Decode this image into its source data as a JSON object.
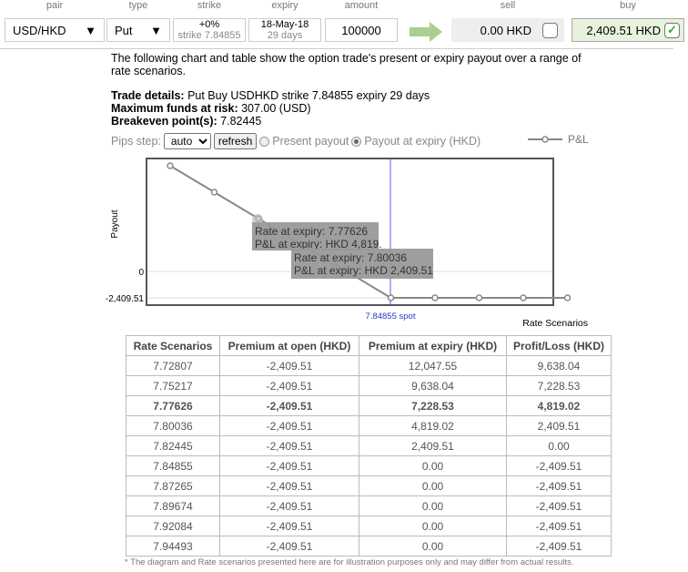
{
  "header": {
    "pair": "pair",
    "type": "type",
    "strike": "strike",
    "expiry": "expiry",
    "amount": "amount",
    "sell": "sell",
    "buy": "buy"
  },
  "form": {
    "pair": "USD/HKD",
    "type": "Put",
    "strike_pct": "+0%",
    "strike": "strike 7.84855",
    "expiry_date": "18-May-18",
    "expiry_days": "29 days",
    "amount": "100000",
    "sell_price": "0.00 HKD",
    "buy_price": "2,409.51 HKD",
    "buy_checked": true,
    "sell_checked": false
  },
  "intro": "The following chart and table show the option trade's present or expiry payout over a range of rate scenarios.",
  "details": {
    "trade_label": "Trade details:",
    "trade": " Put Buy USDHKD strike 7.84855 expiry 29 days",
    "risk_label": "Maximum funds at risk:",
    "risk": " 307.00 (USD)",
    "be_label": "Breakeven point(s):",
    "be": " 7.82445"
  },
  "controls": {
    "pips_label": "Pips step:",
    "pips_value": "auto",
    "refresh": "refresh",
    "present": "Present payout",
    "expiry": "Payout at expiry (HKD)",
    "selected": "expiry"
  },
  "chart_data": {
    "type": "line",
    "legend": "P&L",
    "ylabel": "Payout",
    "xlabel": "Rate Scenarios",
    "y_ticks": [
      "0",
      "-2,409.51"
    ],
    "spot_label": "7.84855 spot",
    "spot": 7.84855,
    "x": [
      7.72807,
      7.75217,
      7.77626,
      7.80036,
      7.82445,
      7.84855,
      7.87265,
      7.89674,
      7.92084,
      7.94493
    ],
    "values": [
      9638.04,
      7228.53,
      4819.02,
      2409.51,
      0,
      -2409.51,
      -2409.51,
      -2409.51,
      -2409.51,
      -2409.51
    ],
    "tooltips": [
      {
        "rate": "Rate at expiry: 7.77626",
        "pl": "P&L at expiry: HKD 4,819."
      },
      {
        "rate": "Rate at expiry: 7.80036",
        "pl": "P&L at expiry: HKD 2,409.51"
      }
    ]
  },
  "table": {
    "headers": [
      "Rate Scenarios",
      "Premium at open (HKD)",
      "Premium at expiry (HKD)",
      "Profit/Loss (HKD)"
    ],
    "rows": [
      [
        "7.72807",
        "-2,409.51",
        "12,047.55",
        "9,638.04"
      ],
      [
        "7.75217",
        "-2,409.51",
        "9,638.04",
        "7,228.53"
      ],
      [
        "7.77626",
        "-2,409.51",
        "7,228.53",
        "4,819.02"
      ],
      [
        "7.80036",
        "-2,409.51",
        "4,819.02",
        "2,409.51"
      ],
      [
        "7.82445",
        "-2,409.51",
        "2,409.51",
        "0.00"
      ],
      [
        "7.84855",
        "-2,409.51",
        "0.00",
        "-2,409.51"
      ],
      [
        "7.87265",
        "-2,409.51",
        "0.00",
        "-2,409.51"
      ],
      [
        "7.89674",
        "-2,409.51",
        "0.00",
        "-2,409.51"
      ],
      [
        "7.92084",
        "-2,409.51",
        "0.00",
        "-2,409.51"
      ],
      [
        "7.94493",
        "-2,409.51",
        "0.00",
        "-2,409.51"
      ]
    ],
    "bold_row": 2
  },
  "footnote": "* The diagram and Rate scenarios presented here are for illustration purposes only and may differ from actual results."
}
